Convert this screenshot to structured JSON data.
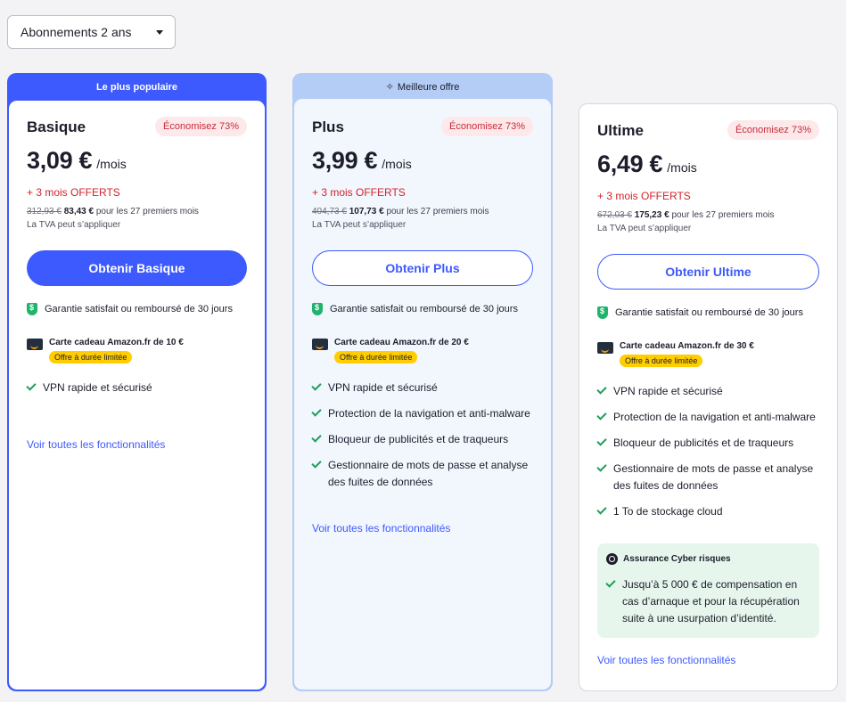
{
  "subscription_select": {
    "value": "Abonnements 2 ans"
  },
  "plans": [
    {
      "ribbon": "Le plus populaire",
      "name": "Basique",
      "savings": "Économisez 73%",
      "price": "3,09 €",
      "per": "/mois",
      "free_months": "+ 3 mois OFFERTS",
      "old_price": "312,93 €",
      "new_price": "83,43 €",
      "period_text": "pour les 27 premiers mois",
      "vat": "La TVA peut s’appliquer",
      "cta": "Obtenir Basique",
      "guarantee": "Garantie satisfait ou remboursé de 30 jours",
      "gift": "Carte cadeau Amazon.fr de 10 €",
      "limited": "Offre à durée limitée",
      "features": [
        "VPN rapide et sécurisé"
      ],
      "link": "Voir toutes les fonctionnalités"
    },
    {
      "ribbon": "Meilleure offre",
      "name": "Plus",
      "savings": "Économisez 73%",
      "price": "3,99 €",
      "per": "/mois",
      "free_months": "+ 3 mois OFFERTS",
      "old_price": "404,73 €",
      "new_price": "107,73 €",
      "period_text": "pour les 27 premiers mois",
      "vat": "La TVA peut s’appliquer",
      "cta": "Obtenir Plus",
      "guarantee": "Garantie satisfait ou remboursé de 30 jours",
      "gift": "Carte cadeau Amazon.fr de 20 €",
      "limited": "Offre à durée limitée",
      "features": [
        "VPN rapide et sécurisé",
        "Protection de la navigation et anti-malware",
        "Bloqueur de publicités et de traqueurs",
        "Gestionnaire de mots de passe et analyse des fuites de données"
      ],
      "link": "Voir toutes les fonctionnalités"
    },
    {
      "name": "Ultime",
      "savings": "Économisez 73%",
      "price": "6,49 €",
      "per": "/mois",
      "free_months": "+ 3 mois OFFERTS",
      "old_price": "672,03 €",
      "new_price": "175,23 €",
      "period_text": "pour les 27 premiers mois",
      "vat": "La TVA peut s’appliquer",
      "cta": "Obtenir Ultime",
      "guarantee": "Garantie satisfait ou remboursé de 30 jours",
      "gift": "Carte cadeau Amazon.fr de 30 €",
      "limited": "Offre à durée limitée",
      "features": [
        "VPN rapide et sécurisé",
        "Protection de la navigation et anti-malware",
        "Bloqueur de publicités et de traqueurs",
        "Gestionnaire de mots de passe et analyse des fuites de données",
        "1 To de stockage cloud"
      ],
      "insurance": {
        "title": "Assurance Cyber risques",
        "item": "Jusqu’à 5 000 € de compensation en cas d’arnaque et pour la récupération suite à une usurpation d’identité."
      },
      "link": "Voir toutes les fonctionnalités"
    }
  ],
  "colors": {
    "accent": "#3d5afe",
    "savings_text": "#c62d3a",
    "offer_red": "#d2232a",
    "check_green": "#1e9e59",
    "limited_yellow": "#ffcd00"
  }
}
